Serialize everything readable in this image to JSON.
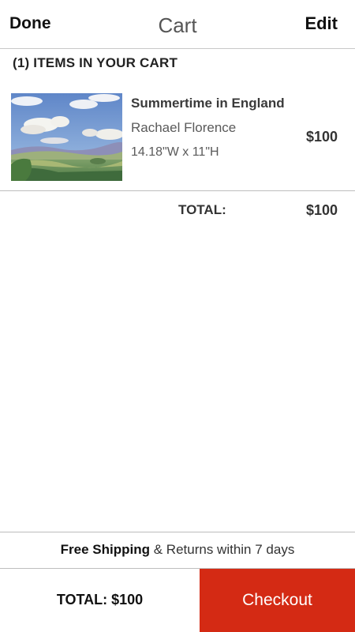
{
  "nav": {
    "done_label": "Done",
    "title": "Cart",
    "edit_label": "Edit"
  },
  "cart": {
    "items_heading": "(1) ITEMS IN YOUR CART",
    "items": [
      {
        "title": "Summertime in England",
        "artist": "Rachael Florence",
        "dimensions": "14.18\"W x 11\"H",
        "price": "$100",
        "thumbnail": "landscape-painting-thumbnail"
      }
    ],
    "total_label": "TOTAL:",
    "total_value": "$100"
  },
  "shipping": {
    "bold_text": "Free Shipping",
    "rest_text": " & Returns within 7 days"
  },
  "footer": {
    "total_text": "TOTAL: $100",
    "checkout_label": "Checkout",
    "checkout_color": "#d42a14"
  }
}
